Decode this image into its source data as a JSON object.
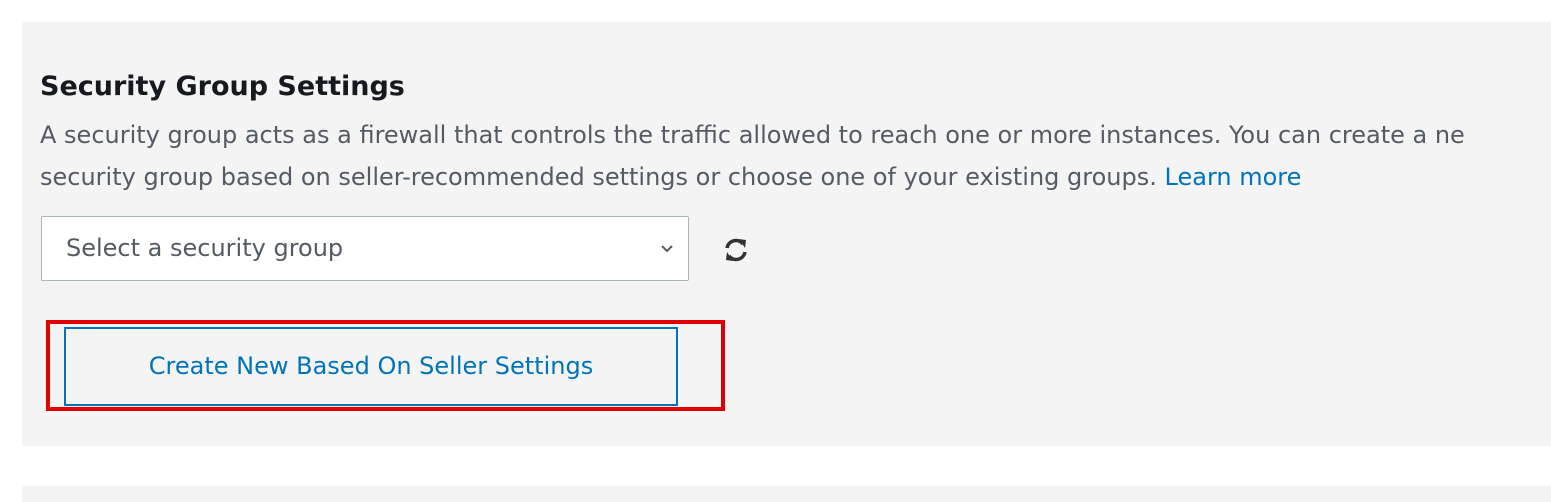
{
  "section": {
    "title": "Security Group Settings",
    "description_line1": "A security group acts as a firewall that controls the traffic allowed to reach one or more instances. You can create a ne",
    "description_line2": "security group based on seller-recommended settings or choose one of your existing groups.",
    "learn_more": "Learn more"
  },
  "security_group_select": {
    "selected_value": "Select a security group"
  },
  "refresh": {
    "icon": "refresh-icon"
  },
  "create_button": {
    "label": "Create New Based On Seller Settings",
    "highlight_color": "#e00000"
  },
  "colors": {
    "panel_background": "#f4f4f4",
    "link": "#0073bb",
    "title_text": "#16191f",
    "body_text": "#545b64"
  }
}
